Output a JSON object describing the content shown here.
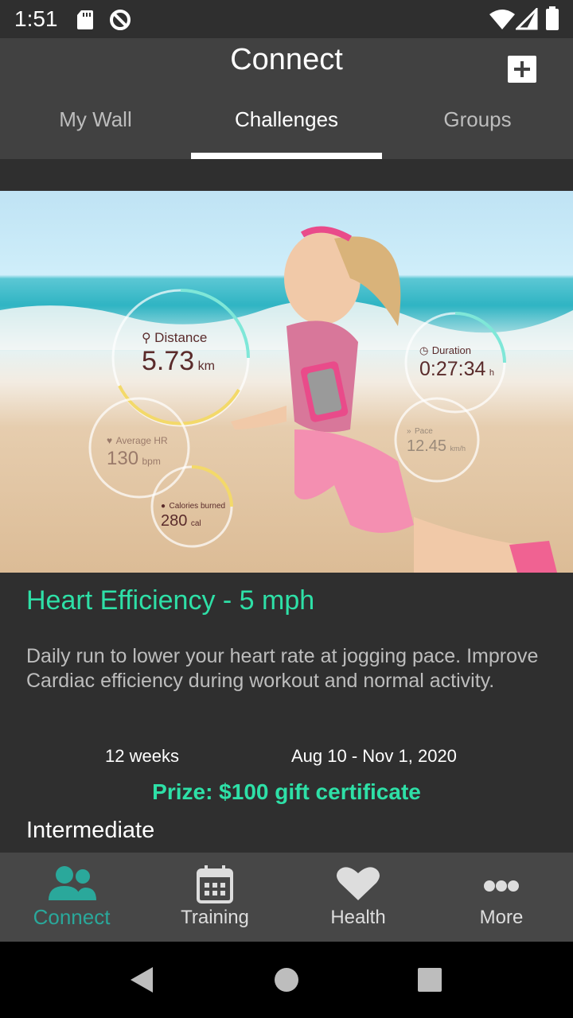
{
  "status_bar": {
    "time": "1:51"
  },
  "app_bar": {
    "title": "Connect",
    "tabs": [
      {
        "label": "My Wall",
        "active": false
      },
      {
        "label": "Challenges",
        "active": true
      },
      {
        "label": "Groups",
        "active": false
      }
    ]
  },
  "hero": {
    "metrics": {
      "distance": {
        "label": "Distance",
        "value": "5.73",
        "unit": "km"
      },
      "duration": {
        "label": "Duration",
        "value": "0:27:34",
        "unit": "h"
      },
      "average_hr": {
        "label": "Average HR",
        "value": "130",
        "unit": "bpm"
      },
      "pace": {
        "label": "Pace",
        "value": "12.45",
        "unit": "km/h"
      },
      "calories": {
        "label": "Calories burned",
        "value": "280",
        "unit": "cal"
      }
    }
  },
  "challenge": {
    "title": "Heart Efficiency - 5 mph",
    "description": "Daily run to lower your heart rate at jogging pace. Improve Cardiac efficiency during workout and normal activity.",
    "duration": "12 weeks",
    "dates": "Aug 10 - Nov 1, 2020",
    "prize": "Prize: $100 gift certificate",
    "level": "Intermediate"
  },
  "bottom_nav": {
    "items": [
      {
        "label": "Connect",
        "icon": "people-icon",
        "active": true
      },
      {
        "label": "Training",
        "icon": "calendar-icon",
        "active": false
      },
      {
        "label": "Health",
        "icon": "heart-icon",
        "active": false
      },
      {
        "label": "More",
        "icon": "more-dots-icon",
        "active": false
      }
    ]
  },
  "colors": {
    "accent": "#2ee0a7",
    "nav_active": "#2aa89b",
    "app_bar": "#414141",
    "background": "#2f2f2f"
  }
}
